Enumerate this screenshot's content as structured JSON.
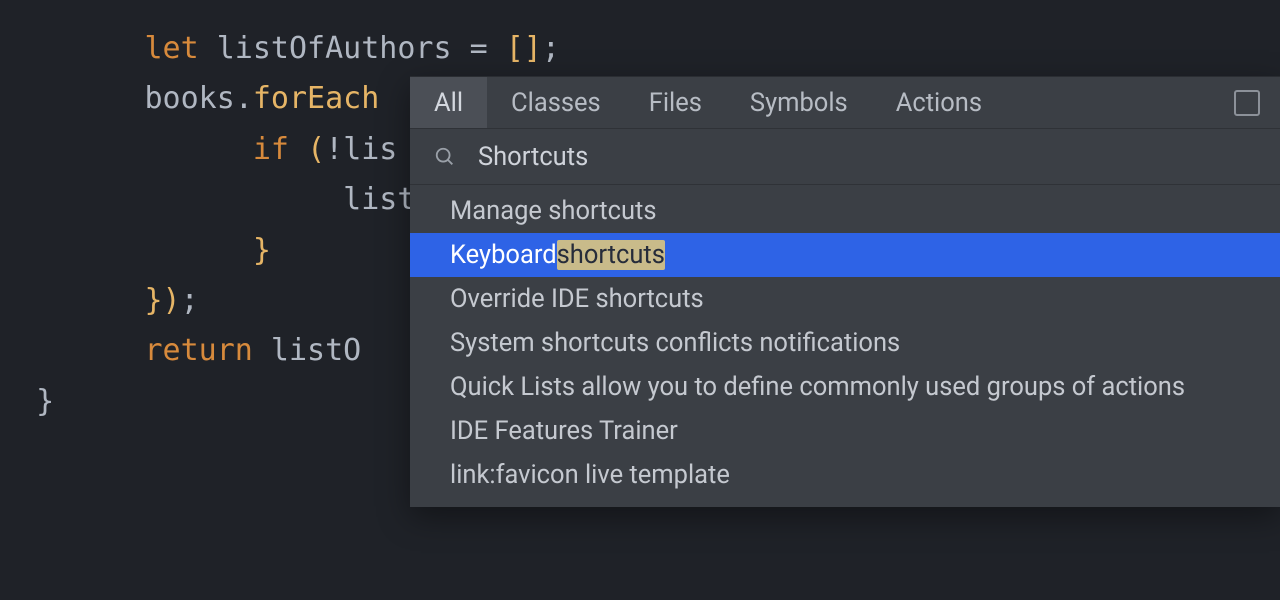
{
  "editor": {
    "lines": [
      {
        "indent": "        ",
        "tokens": [
          {
            "cls": "kw",
            "t": "let"
          },
          {
            "cls": "id",
            "t": " listOfAuthors "
          },
          {
            "cls": "punc",
            "t": "= "
          },
          {
            "cls": "br",
            "t": "[]"
          },
          {
            "cls": "punc",
            "t": ";"
          }
        ]
      },
      {
        "indent": "        ",
        "tokens": [
          {
            "cls": "id",
            "t": "books"
          },
          {
            "cls": "punc",
            "t": "."
          },
          {
            "cls": "fn",
            "t": "forEach"
          }
        ]
      },
      {
        "indent": "              ",
        "tokens": [
          {
            "cls": "kw",
            "t": "if"
          },
          {
            "cls": "id",
            "t": " "
          },
          {
            "cls": "br",
            "t": "("
          },
          {
            "cls": "punc",
            "t": "!"
          },
          {
            "cls": "id",
            "t": "lis"
          }
        ]
      },
      {
        "indent": "                   ",
        "tokens": [
          {
            "cls": "id",
            "t": "list"
          }
        ]
      },
      {
        "indent": "              ",
        "tokens": [
          {
            "cls": "br",
            "t": "}"
          }
        ]
      },
      {
        "indent": "        ",
        "tokens": [
          {
            "cls": "br",
            "t": "})"
          },
          {
            "cls": "punc",
            "t": ";"
          }
        ]
      },
      {
        "indent": "        ",
        "tokens": [
          {
            "cls": "kw",
            "t": "return"
          },
          {
            "cls": "id",
            "t": " listO"
          }
        ]
      },
      {
        "indent": "  ",
        "tokens": [
          {
            "cls": "id",
            "t": "}"
          }
        ]
      }
    ]
  },
  "popup": {
    "tabs": [
      {
        "label": "All",
        "active": true
      },
      {
        "label": "Classes",
        "active": false
      },
      {
        "label": "Files",
        "active": false
      },
      {
        "label": "Symbols",
        "active": false
      },
      {
        "label": "Actions",
        "active": false
      }
    ],
    "search_value": "Shortcuts",
    "results": [
      {
        "prefix": "Manage shortcuts",
        "match": "",
        "suffix": "",
        "selected": false
      },
      {
        "prefix": "Keyboard ",
        "match": "shortcuts",
        "suffix": "",
        "selected": true
      },
      {
        "prefix": "Override IDE shortcuts",
        "match": "",
        "suffix": "",
        "selected": false
      },
      {
        "prefix": "System shortcuts conflicts notifications",
        "match": "",
        "suffix": "",
        "selected": false
      },
      {
        "prefix": "Quick Lists allow you to define commonly used groups of actions",
        "match": "",
        "suffix": "",
        "selected": false
      },
      {
        "prefix": "IDE Features Trainer",
        "match": "",
        "suffix": "",
        "selected": false
      },
      {
        "prefix": "link:favicon live template",
        "match": "",
        "suffix": "",
        "selected": false
      }
    ]
  }
}
